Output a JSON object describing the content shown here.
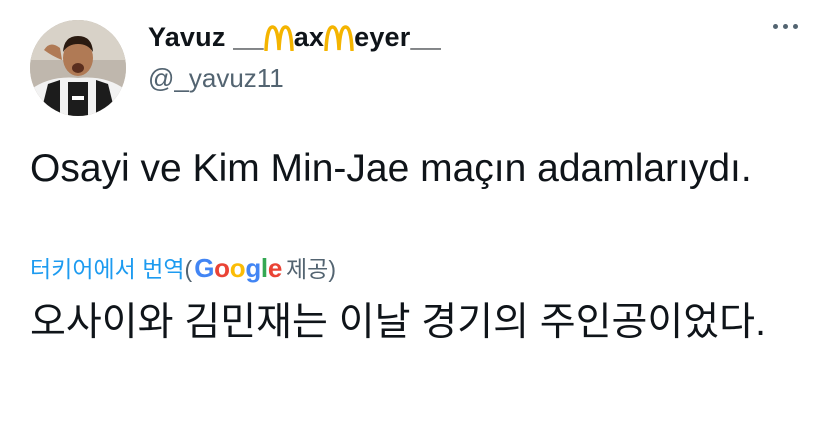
{
  "author": {
    "name_parts": [
      "Yavuz __",
      "ax ",
      "eyer__"
    ],
    "handle": "@_yavuz11",
    "avatar_icon": "profile-photo",
    "name_glyph_icon": "mcdonalds-arch-icon",
    "name_glyph_color": "#f4b400"
  },
  "tweet": {
    "text": "Osayi ve Kim Min-Jae maçın adamlarıydı.",
    "translate_label": "터키어에서 번역",
    "open_paren": "(",
    "google_letters": [
      "G",
      "o",
      "o",
      "g",
      "l",
      "e"
    ],
    "provided_label": " 제공)",
    "translated_text": "오사이와 김민재는 이날 경기의 주인공이었다."
  },
  "more_menu": {
    "icon": "more-options-icon"
  },
  "colors": {
    "link": "#1d9bf0",
    "muted": "#536471",
    "text": "#0f1419"
  }
}
